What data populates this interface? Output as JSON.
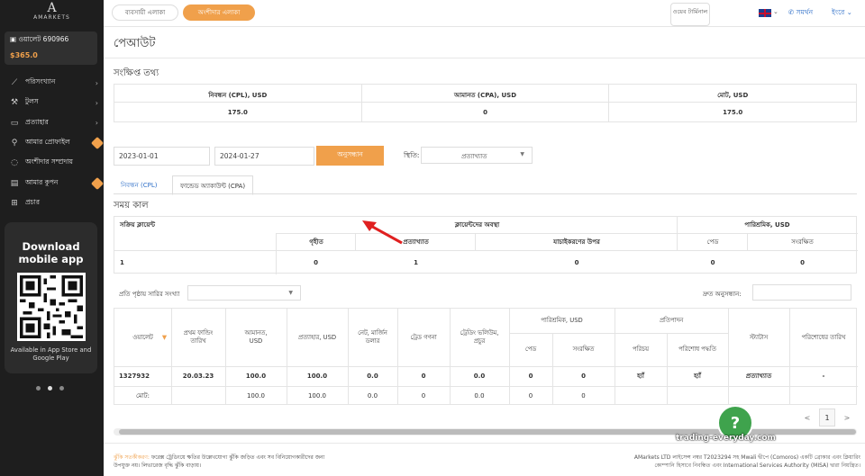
{
  "sidebar": {
    "logo_text": "AMARKETS",
    "wallet_label": "ওয়ালেট 690966",
    "wallet_balance": "$365.0",
    "items": [
      {
        "icon": "chart-line-icon",
        "label": "পরিসংখ্যান",
        "chevron": true
      },
      {
        "icon": "wrench-icon",
        "label": "টুলস",
        "chevron": true
      },
      {
        "icon": "chat-icon",
        "label": "প্রত্যাহার",
        "chevron": true
      },
      {
        "icon": "user-icon",
        "label": "আমার প্রোফাইল",
        "hot": true
      },
      {
        "icon": "handshake-icon",
        "label": "অংশীদার সম্প্রদায়"
      },
      {
        "icon": "ticket-icon",
        "label": "আমার কুপন",
        "hot": true
      },
      {
        "icon": "gift-icon",
        "label": "প্রচার"
      }
    ],
    "promo": {
      "title": "Download mobile app",
      "subtitle": "Available in App Store and Google Play"
    }
  },
  "topbar": {
    "tab_trader": "ব্যবসায়ী এলাকা",
    "tab_partner": "অংশীদার এলাকা",
    "web_label": "ওয়েব টার্মিনাল",
    "support": "সমর্থন",
    "language": "ইংরে"
  },
  "page": {
    "title": "পেআউট",
    "summary_title": "সংক্ষিপ্ত তথ্য",
    "summary": [
      {
        "label": "নিবন্ধন (CPL), USD",
        "value": "175.0"
      },
      {
        "label": "আমানত (CPA), USD",
        "value": "0"
      },
      {
        "label": "মোট, USD",
        "value": "175.0"
      }
    ]
  },
  "filters": {
    "date_from": "2023-01-01",
    "date_to": "2024-01-27",
    "search_button": "অনুসন্ধান",
    "status_label": "স্থিতি:",
    "status_value": "প্রত্যাখ্যাত"
  },
  "tabs": {
    "cpl": "নিবন্ধন (CPL)",
    "cpa": "ফান্ডেড অ্যাকাউন্ট (CPA)"
  },
  "period": {
    "title": "সময় কাল",
    "h_active": "সক্রিয় ক্লায়েন্ট",
    "h_status": "ক্লায়েন্টদের অবস্থা",
    "h_reward": "পারিশ্রমিক, USD",
    "h_accepted": "গৃহীত",
    "h_rejected": "প্রত্যাখ্যাত",
    "h_checking": "যাচাইকরণের উপর",
    "h_paid": "পেড",
    "h_reserved": "সংরক্ষিত",
    "v_active": "1",
    "v_accepted": "0",
    "v_rejected": "1",
    "v_checking": "0",
    "v_paid": "0",
    "v_reserved": "0"
  },
  "table": {
    "rows_label": "প্রতি পৃষ্ঠায় সারির সংখ্যা",
    "quick_search": "দ্রুত অনুসন্ধান:",
    "h_wallet": "ওয়ালেট",
    "h_first_funding": "প্রথম ফান্ডিং তারিখ",
    "h_deposit": "আমানত, USD",
    "h_withdrawal": "প্রত্যাহার, USD",
    "h_net_margin": "নেট, মার্জিন ডলার",
    "h_trade_count": "ট্রেড গণনা",
    "h_trade_volume": "ট্রেডিং ভলিউম, প্রচুর",
    "h_reward": "পারিশ্রমিক, USD",
    "h_paid": "পেড",
    "h_reserved": "সংরক্ষিত",
    "h_verification": "প্রতিপাদন",
    "h_identity": "পরিচয়",
    "h_pay_method": "পরিশোধ পদ্ধতি",
    "h_status": "স্ট্যাটাস",
    "h_pay_date": "পরিশোধের তারিখ",
    "row": {
      "wallet": "1327932",
      "first_funding": "20.03.23",
      "deposit": "100.0",
      "withdrawal": "100.0",
      "net_margin": "0.0",
      "trade_count": "0",
      "trade_volume": "0.0",
      "paid": "0",
      "reserved": "0",
      "identity": "হ্যাঁ",
      "pay_method": "হ্যাঁ",
      "status": "প্রত্যাখ্যাত",
      "pay_date": "-"
    },
    "total": {
      "label": "মোট:",
      "deposit": "100.0",
      "withdrawal": "100.0",
      "net_margin": "0.0",
      "trade_count": "0",
      "trade_volume": "0.0",
      "paid": "0",
      "reserved": "0"
    },
    "pager_prev": "<",
    "pager_current": "1",
    "pager_next": ">"
  },
  "footer": {
    "risk_label": "ঝুঁকি সতর্কীকরণ:",
    "risk_text": "ফরেক্স ট্রেডিংয়ে ক্ষতির উল্লেখযোগ্য ঝুঁকি জড়িত এবং সব বিনিয়োগকারীদের জন্য উপযুক্ত নয়। লিভারেজ বৃদ্ধি ঝুঁকি বাড়ায়।",
    "legal_text": "AMarkets LTD লাইসেন্স নম্বর T2023294 সহ Mwali দ্বীপে (Comoros) একটি ব্রোকার এবং ক্লিয়ারিং কোম্পানি হিসাবে নিবন্ধিত এবং International Services Authority (MISA) দ্বারা নিয়ন্ত্রিত।"
  },
  "watermark": "trading-everyday.com",
  "colors": {
    "accent": "#f0a04b",
    "link": "#2f6fc8",
    "sidebar": "#1e1e1e",
    "help": "#3fa34d",
    "arrow": "#e02020"
  }
}
